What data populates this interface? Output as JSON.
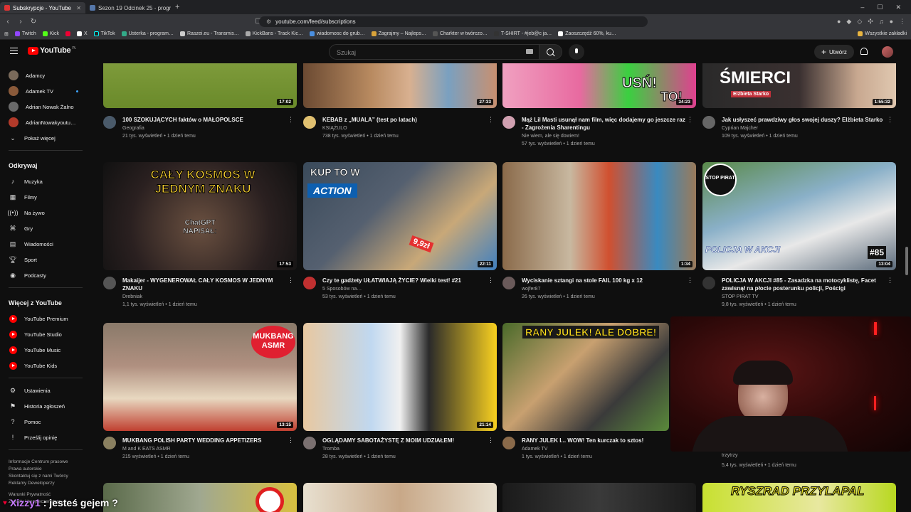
{
  "browser": {
    "tabs": [
      {
        "label": "Subskrypcje - YouTube",
        "active": true
      },
      {
        "label": "Sezon 19 Odcinek 25 - program onli…",
        "active": false
      }
    ],
    "url": "youtube.com/feed/subscriptions",
    "bookmarks": [
      "Twitch",
      "Kick",
      "X",
      "TikTok",
      "Usterka - program…",
      "Raszei.eu - Transmis…",
      "KickBans - Track Kic…",
      "wiadomosc do grub…",
      "Zagrajmy – Najleps…",
      "Charkter w twórczo…",
      "T-SHIRT - #jeb@c ja…",
      "Zaoszczędź 60%, ku…"
    ],
    "bookmarks_all": "Wszystkie zakładki"
  },
  "header": {
    "logo": "YouTube",
    "region": "PL",
    "search_placeholder": "Szukaj",
    "create_label": "Utwórz"
  },
  "sidebar": {
    "channels": [
      {
        "name": "Adamcy",
        "color": "#7a6a5a",
        "live": false
      },
      {
        "name": "Adamek TV",
        "color": "#8a5a3a",
        "live": true
      },
      {
        "name": "Adrian Nowak Żalno",
        "color": "#6a6a6a",
        "live": false
      },
      {
        "name": "AdrianNowakyoutu…",
        "color": "#b23a2a",
        "live": true
      }
    ],
    "show_more": "Pokaż więcej",
    "explore_heading": "Odkrywaj",
    "explore": [
      "Muzyka",
      "Filmy",
      "Na żywo",
      "Gry",
      "Wiadomości",
      "Sport",
      "Podcasty"
    ],
    "more_heading": "Więcej z YouTube",
    "more": [
      "YouTube Premium",
      "YouTube Studio",
      "YouTube Music",
      "YouTube Kids"
    ],
    "settings": [
      "Ustawienia",
      "Historia zgłoszeń",
      "Pomoc",
      "Prześlij opinię"
    ],
    "footer1": "Informacje  Centrum prasowe",
    "footer2": "Prawa autorskie",
    "footer3": "Skontaktuj się z nami  Twórcy",
    "footer4": "Reklamy  Deweloperzy",
    "footer5": "Warunki  Prywatność",
    "footer6": "Zasady i bezpieczeństwo"
  },
  "videos": [
    {
      "title": "100 SZOKUJĄCYCH faktów o MAŁOPOLSCE",
      "channel": "Geografia",
      "stats": "21 tys. wyświetleń • 1 dzień temu",
      "duration": "17:02",
      "verified": false
    },
    {
      "title": "KEBAB z „MUALA” (test po latach)",
      "channel": "KSIĄŻULO",
      "stats": "738 tys. wyświetleń • 1 dzień temu",
      "duration": "27:33",
      "verified": true
    },
    {
      "title": "Mąż Lil Masti usunął nam film, więc dodajemy go jeszcze raz  - Zagrożenia Sharentingu",
      "channel": "Nie wiem, ale się dowiem!",
      "stats": "57 tys. wyświetleń • 1 dzień temu",
      "duration": "34:23",
      "verified": true
    },
    {
      "title": "Jak usłyszeć prawdziwy głos swojej duszy? Elżbieta Starko",
      "channel": "Cyprian Majcher",
      "stats": "109 tys. wyświetleń • 1 dzień temu",
      "duration": "1:55:32",
      "verified": true
    },
    {
      "title": "Makaijer - WYGENEROWAŁ CAŁY KOSMOS W JEDNYM ZNAKU",
      "channel": "Drebniak",
      "stats": "1,1 tys. wyświetleń • 1 dzień temu",
      "duration": "17:53",
      "verified": false
    },
    {
      "title": "Czy te gadżety UŁATWIAJĄ ŻYCIE? Wielki test! #21",
      "channel": "5 Sposobów na…",
      "stats": "53 tys. wyświetleń • 1 dzień temu",
      "duration": "22:11",
      "verified": true
    },
    {
      "title": "Wyciskanie sztangi na stole FAIL 100 kg x 12",
      "channel": "wojfer87",
      "stats": "26 tys. wyświetleń • 1 dzień temu",
      "duration": "1:34",
      "verified": false
    },
    {
      "title": "POLICJA W AKCJI #85 - Zasadzka na motocyklistę, Facet zawisnął na płocie posterunku policji, Pościgi",
      "channel": "STOP PIRAT TV",
      "stats": "9,8 tys. wyświetleń • 1 dzień temu",
      "duration": "13:04",
      "verified": false
    },
    {
      "title": "MUKBANG POLISH PARTY WEDDING APPETIZERS",
      "channel": "M and K EATS ASMR",
      "stats": "215 wyświetleń • 1 dzień temu",
      "duration": "13:15",
      "verified": false
    },
    {
      "title": "OGLĄDAMY SABOTAŻYSTĘ Z MOIM UDZIAŁEM!",
      "channel": "Tromba",
      "stats": "28 tys. wyświetleń • 1 dzień temu",
      "duration": "21:14",
      "verified": true
    },
    {
      "title": "RANY JULEK I... WOW! Ten kurczak to sztos!",
      "channel": "Adamek TV",
      "stats": "1 tys. wyświetleń • 1 dzień temu",
      "duration": "",
      "verified": false
    },
    {
      "title": "",
      "channel": "trzytrzy",
      "stats": "5,4 tys. wyświetleń • 1 dzień temu",
      "duration": "",
      "verified": false
    }
  ],
  "thumb_texts": {
    "v1": "USŃ!",
    "v1b": "TO!",
    "v1c": "ŚMIERCI",
    "v1d": "Elżbieta Starko",
    "v4": "CAŁY KOSMOS W JEDNYM ZNAKU",
    "v4b": "ChatGPT NAPISAŁ:",
    "v5a": "KUP TO W",
    "v5b": "ACTION",
    "v5c": "9,9zł",
    "v7a": "POLICJA W AKCJI",
    "v7b": "#85",
    "v7c": "STOP PIRAT",
    "v8": "MUKBANG ASMR",
    "v10": "RANY JULEK! ALE DOBRE!",
    "v_next": "RYSZRAD PRZYLAPAL"
  },
  "chat": {
    "user": "Xizzy1",
    "message": ": jesteś gejem ?"
  }
}
